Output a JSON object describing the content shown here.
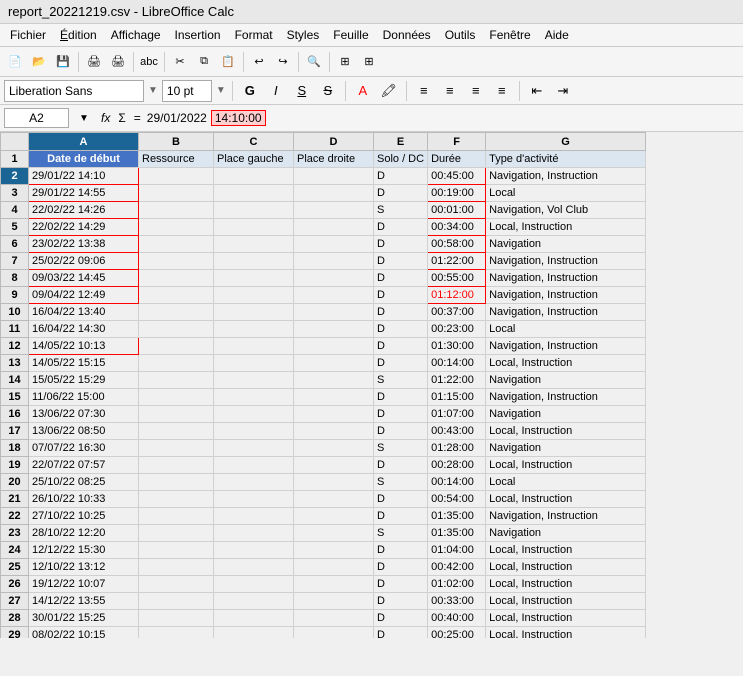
{
  "titleBar": {
    "title": "report_20221219.csv - LibreOffice Calc"
  },
  "menuBar": {
    "items": [
      {
        "label": "Fichier",
        "underline": "F"
      },
      {
        "label": "Édition",
        "underline": "É"
      },
      {
        "label": "Affichage",
        "underline": "A"
      },
      {
        "label": "Insertion",
        "underline": "I"
      },
      {
        "label": "Format",
        "underline": "o"
      },
      {
        "label": "Styles",
        "underline": "S"
      },
      {
        "label": "Feuille",
        "underline": "e"
      },
      {
        "label": "Données",
        "underline": "n"
      },
      {
        "label": "Outils",
        "underline": "u"
      },
      {
        "label": "Fenêtre",
        "underline": "ê"
      },
      {
        "label": "Aide",
        "underline": "d"
      }
    ]
  },
  "fontBar": {
    "fontName": "Liberation Sans",
    "fontSize": "10 pt",
    "boldLabel": "G",
    "italicLabel": "I",
    "underlineLabel": "S",
    "strikethroughLabel": "S"
  },
  "formulaBar": {
    "cellRef": "A2",
    "formulaText": "29/01/2022",
    "highlightedPart": "14:10:00"
  },
  "columns": {
    "headers": [
      "",
      "A",
      "B",
      "C",
      "D",
      "E",
      "F",
      "G"
    ]
  },
  "rows": [
    {
      "row": 1,
      "cells": [
        "Date de début",
        "Ressource",
        "Place gauche",
        "Place droite",
        "Solo / DC",
        "Durée",
        "Type d'activité"
      ]
    },
    {
      "row": 2,
      "cells": [
        "29/01/22 14:10",
        "",
        "",
        "",
        "D",
        "00:45:00",
        "Navigation, Instruction"
      ],
      "highlight": "active"
    },
    {
      "row": 3,
      "cells": [
        "29/01/22 14:55",
        "",
        "",
        "",
        "D",
        "00:19:00",
        "Local"
      ]
    },
    {
      "row": 4,
      "cells": [
        "22/02/22 14:26",
        "",
        "",
        "",
        "S",
        "00:01:00",
        "Navigation, Vol Club"
      ]
    },
    {
      "row": 5,
      "cells": [
        "22/02/22 14:29",
        "",
        "",
        "",
        "D",
        "00:34:00",
        "Local, Instruction"
      ]
    },
    {
      "row": 6,
      "cells": [
        "23/02/22 13:38",
        "",
        "",
        "",
        "D",
        "00:58:00",
        "Navigation"
      ]
    },
    {
      "row": 7,
      "cells": [
        "25/02/22 09:06",
        "",
        "",
        "",
        "D",
        "01:22:00",
        "Navigation, Instruction"
      ]
    },
    {
      "row": 8,
      "cells": [
        "09/03/22 14:45",
        "",
        "",
        "",
        "D",
        "00:55:00",
        "Navigation, Instruction"
      ]
    },
    {
      "row": 9,
      "cells": [
        "09/04/22 12:49",
        "",
        "",
        "",
        "D",
        "01:12:00",
        "Navigation, Instruction"
      ],
      "redOutline": true
    },
    {
      "row": 10,
      "cells": [
        "16/04/22 13:40",
        "",
        "",
        "",
        "D",
        "00:37:00",
        "Navigation, Instruction"
      ]
    },
    {
      "row": 11,
      "cells": [
        "16/04/22 14:30",
        "",
        "",
        "",
        "D",
        "00:23:00",
        "Local"
      ]
    },
    {
      "row": 12,
      "cells": [
        "14/05/22 10:13",
        "",
        "",
        "",
        "D",
        "01:30:00",
        "Navigation, Instruction"
      ],
      "redOutlineA": true
    },
    {
      "row": 13,
      "cells": [
        "14/05/22 15:15",
        "",
        "",
        "",
        "D",
        "00:14:00",
        "Local, Instruction"
      ]
    },
    {
      "row": 14,
      "cells": [
        "15/05/22 15:29",
        "",
        "",
        "",
        "S",
        "01:22:00",
        "Navigation"
      ]
    },
    {
      "row": 15,
      "cells": [
        "11/06/22 15:00",
        "",
        "",
        "",
        "D",
        "01:15:00",
        "Navigation, Instruction"
      ]
    },
    {
      "row": 16,
      "cells": [
        "13/06/22 07:30",
        "",
        "",
        "",
        "D",
        "01:07:00",
        "Navigation"
      ]
    },
    {
      "row": 17,
      "cells": [
        "13/06/22 08:50",
        "",
        "",
        "",
        "D",
        "00:43:00",
        "Local, Instruction"
      ]
    },
    {
      "row": 18,
      "cells": [
        "07/07/22 16:30",
        "",
        "",
        "",
        "S",
        "01:28:00",
        "Navigation"
      ]
    },
    {
      "row": 19,
      "cells": [
        "22/07/22 07:57",
        "",
        "",
        "",
        "D",
        "00:28:00",
        "Local, Instruction"
      ]
    },
    {
      "row": 20,
      "cells": [
        "25/10/22 08:25",
        "",
        "",
        "",
        "S",
        "00:14:00",
        "Local"
      ]
    },
    {
      "row": 21,
      "cells": [
        "26/10/22 10:33",
        "",
        "",
        "",
        "D",
        "00:54:00",
        "Local, Instruction"
      ]
    },
    {
      "row": 22,
      "cells": [
        "27/10/22 10:25",
        "",
        "",
        "",
        "D",
        "01:35:00",
        "Navigation, Instruction"
      ]
    },
    {
      "row": 23,
      "cells": [
        "28/10/22 12:20",
        "",
        "",
        "",
        "S",
        "01:35:00",
        "Navigation"
      ]
    },
    {
      "row": 24,
      "cells": [
        "12/12/22 15:30",
        "",
        "",
        "",
        "D",
        "01:04:00",
        "Local, Instruction"
      ]
    },
    {
      "row": 25,
      "cells": [
        "12/10/22 13:12",
        "",
        "",
        "",
        "D",
        "00:42:00",
        "Local, Instruction"
      ]
    },
    {
      "row": 26,
      "cells": [
        "19/12/22 10:07",
        "",
        "",
        "",
        "D",
        "01:02:00",
        "Local, Instruction"
      ]
    },
    {
      "row": 27,
      "cells": [
        "14/12/22 13:55",
        "",
        "",
        "",
        "D",
        "00:33:00",
        "Local, Instruction"
      ]
    },
    {
      "row": 28,
      "cells": [
        "30/01/22 15:25",
        "",
        "",
        "",
        "D",
        "00:40:00",
        "Local, Instruction"
      ]
    },
    {
      "row": 29,
      "cells": [
        "08/02/22 10:15",
        "",
        "",
        "",
        "D",
        "00:25:00",
        "Local, Instruction"
      ]
    }
  ],
  "redOutlineRows": [
    2,
    3,
    4,
    5,
    6,
    7,
    8,
    9
  ],
  "redOutlineColA": [
    2,
    9,
    12
  ]
}
